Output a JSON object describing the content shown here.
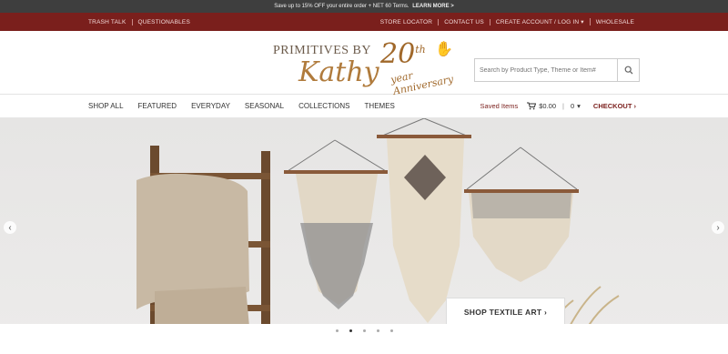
{
  "promo": {
    "text": "Save up to 15% OFF your entire order + NET 60 Terms.",
    "link": "LEARN MORE >"
  },
  "utility": {
    "left": [
      {
        "label": "Trash Talk"
      },
      {
        "label": "Questionables"
      }
    ],
    "right": [
      {
        "label": "Store Locator"
      },
      {
        "label": "Contact Us"
      },
      {
        "label": "Create Account / Log In ▾"
      },
      {
        "label": "Wholesale"
      }
    ]
  },
  "logo": {
    "line1": "PRIMITIVES BY",
    "line2": "Kathy",
    "anniv_num": "20",
    "anniv_sup": "th",
    "anniv_word": "year Anniversary"
  },
  "search": {
    "placeholder": "Search by Product Type, Theme or Item#",
    "icon": "search-icon"
  },
  "nav": {
    "items": [
      {
        "label": "Shop All"
      },
      {
        "label": "Featured"
      },
      {
        "label": "Everyday"
      },
      {
        "label": "Seasonal"
      },
      {
        "label": "Collections"
      },
      {
        "label": "Themes"
      }
    ],
    "saved": "Saved Items",
    "cart_total": "$0.00",
    "cart_count": "0",
    "checkout": "CHECKOUT ›"
  },
  "hero": {
    "cta": "SHOP TEXTILE ART ›",
    "slides": 5,
    "active_slide": 2
  },
  "colors": {
    "brand": "#7a1f1c",
    "promo_bg": "#3e3e3e",
    "logo_gold": "#a0682a"
  }
}
